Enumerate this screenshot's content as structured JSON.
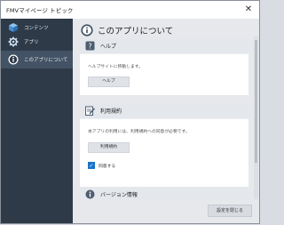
{
  "window": {
    "title": "FMVマイページ トピック",
    "close_glyph": "✕"
  },
  "sidebar": {
    "items": [
      {
        "label": "コンテンツ",
        "icon": "cube-icon"
      },
      {
        "label": "アプリ",
        "icon": "gear-icon"
      },
      {
        "label": "このアプリについて",
        "icon": "info-icon"
      }
    ]
  },
  "main": {
    "title": "このアプリについて",
    "help": {
      "heading": "ヘルプ",
      "description": "ヘルプサイトに移動します。",
      "button": "ヘルプ"
    },
    "terms": {
      "heading": "利用規約",
      "description": "本アプリの利用には、利用規約への同意が必要です。",
      "button": "利用規約",
      "agree_label": "同意する",
      "agreed": true
    },
    "version": {
      "heading": "バージョン情報"
    }
  },
  "footer": {
    "close_button": "設定を閉じる"
  },
  "colors": {
    "sidebar": "#2e3a48",
    "active": "#435264",
    "accent": "#1a73c9"
  }
}
